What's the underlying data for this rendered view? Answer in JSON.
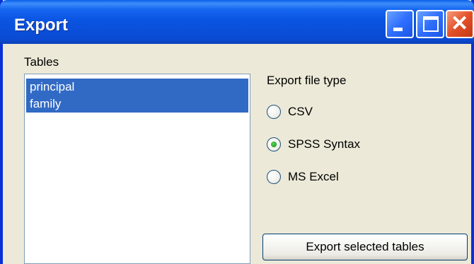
{
  "window": {
    "title": "Export"
  },
  "title_buttons": {
    "minimize": "minimize-icon",
    "maximize": "maximize-icon",
    "close": "close-icon"
  },
  "tables": {
    "label": "Tables",
    "items": [
      "principal",
      "family"
    ]
  },
  "export_type": {
    "label": "Export file type",
    "options": [
      "CSV",
      "SPSS Syntax",
      "MS Excel"
    ],
    "selected": "SPSS Syntax"
  },
  "buttons": {
    "export": "Export selected tables"
  }
}
